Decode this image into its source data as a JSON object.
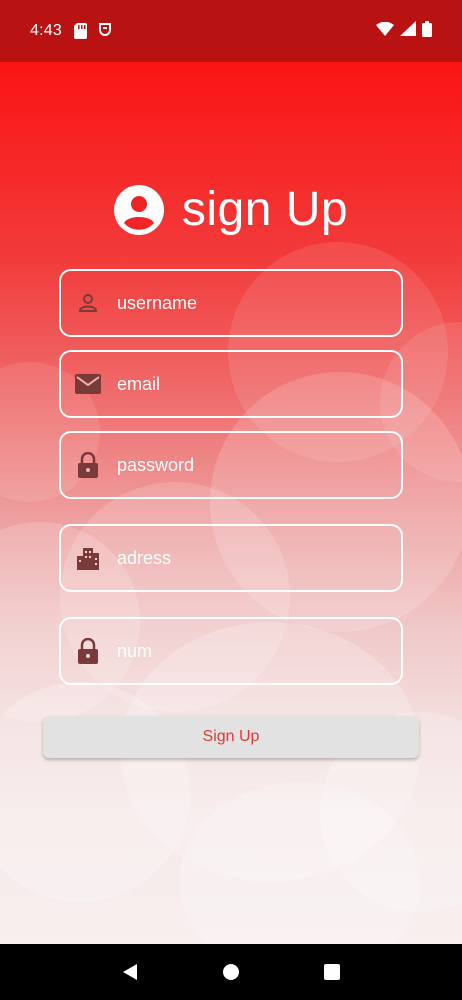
{
  "status_bar": {
    "time": "4:43",
    "left_icons": [
      "sd-card-icon",
      "shield-notification-icon"
    ],
    "right_icons": [
      "wifi-icon",
      "signal-icon",
      "battery-icon"
    ]
  },
  "header": {
    "icon": "account-circle-icon",
    "title": "sign Up"
  },
  "form": {
    "username": {
      "placeholder": "username",
      "icon": "person-icon"
    },
    "email": {
      "placeholder": "email",
      "icon": "email-icon"
    },
    "password": {
      "placeholder": "password",
      "icon": "lock-icon"
    },
    "address": {
      "placeholder": "adress",
      "icon": "building-icon"
    },
    "number": {
      "placeholder": "num",
      "icon": "lock-icon"
    },
    "submit_label": "Sign Up"
  },
  "colors": {
    "accent": "#e53935",
    "status_bar": "#b81212",
    "gradient_top": "#fb1414",
    "icon_tint": "#7a3a3a"
  },
  "nav_bar": {
    "buttons": [
      "back-icon",
      "home-icon",
      "recents-icon"
    ]
  }
}
